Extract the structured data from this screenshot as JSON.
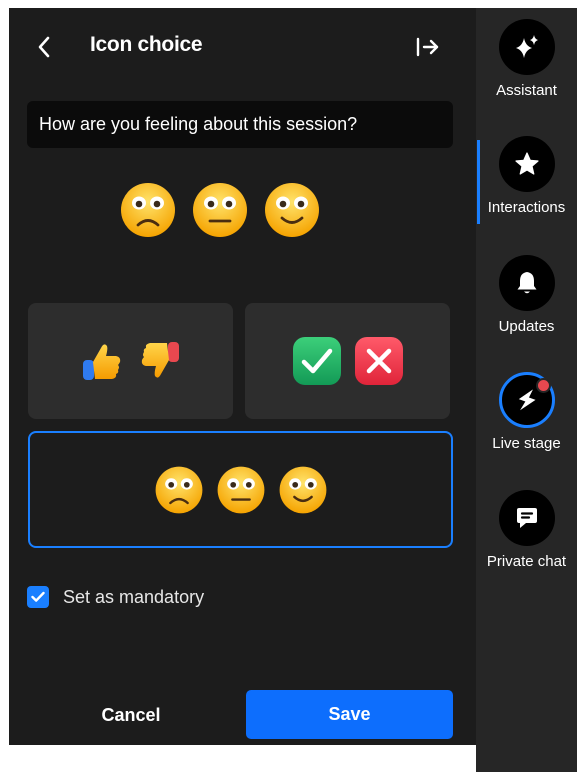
{
  "header": {
    "title": "Icon choice"
  },
  "question": {
    "text": "How are you feeling about this session?"
  },
  "options": [
    {
      "set": "thumbs",
      "icons": [
        "thumbs-up-icon",
        "thumbs-down-icon"
      ]
    },
    {
      "set": "check-cross",
      "icons": [
        "check-mark-icon",
        "cross-mark-icon"
      ]
    },
    {
      "set": "faces",
      "icons": [
        "frowning-face-icon",
        "neutral-face-icon",
        "smiling-face-icon"
      ],
      "selected": true
    }
  ],
  "mandatory": {
    "label": "Set as mandatory",
    "checked": true
  },
  "footer": {
    "cancel_label": "Cancel",
    "save_label": "Save"
  },
  "rail": {
    "items": [
      {
        "label": "Assistant",
        "icon": "sparkles-icon"
      },
      {
        "label": "Interactions",
        "icon": "star-icon",
        "active": true
      },
      {
        "label": "Updates",
        "icon": "bell-icon"
      },
      {
        "label": "Live stage",
        "icon": "lightning-icon",
        "notification": true
      },
      {
        "label": "Private chat",
        "icon": "chat-bubble-icon"
      }
    ]
  },
  "colors": {
    "accent": "#1a7fff",
    "save_button": "#0d6efd",
    "panel_bg": "#1c1c1c",
    "rail_bg": "#262626",
    "notification": "#e8484f"
  }
}
